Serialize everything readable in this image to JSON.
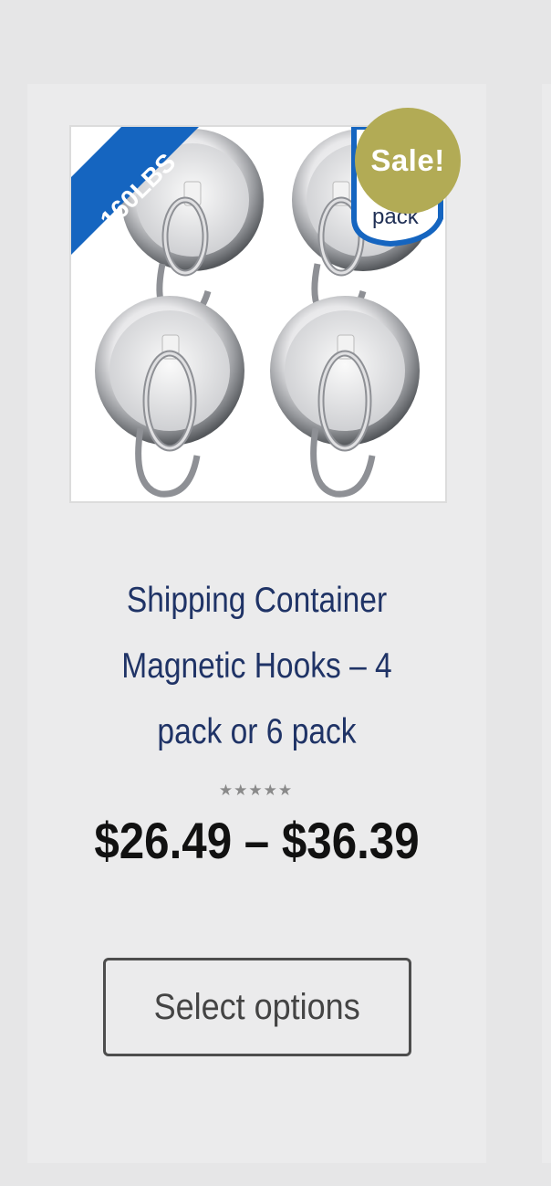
{
  "product": {
    "sale_badge": "Sale!",
    "image_badge_weight": "160LBS",
    "image_badge_pack": "pack",
    "title": "Shipping Container Magnetic Hooks – 4 pack or 6 pack",
    "rating_stars": 5,
    "price": "$26.49 – $36.39",
    "button_label": "Select options"
  },
  "colors": {
    "page_bg": "#e6e6e7",
    "card_bg": "#ebebec",
    "title": "#1f3366",
    "sale_badge": "#b2ab55",
    "image_ribbon": "#1565c0",
    "price": "#111111"
  },
  "icons": [
    "star-icon"
  ]
}
